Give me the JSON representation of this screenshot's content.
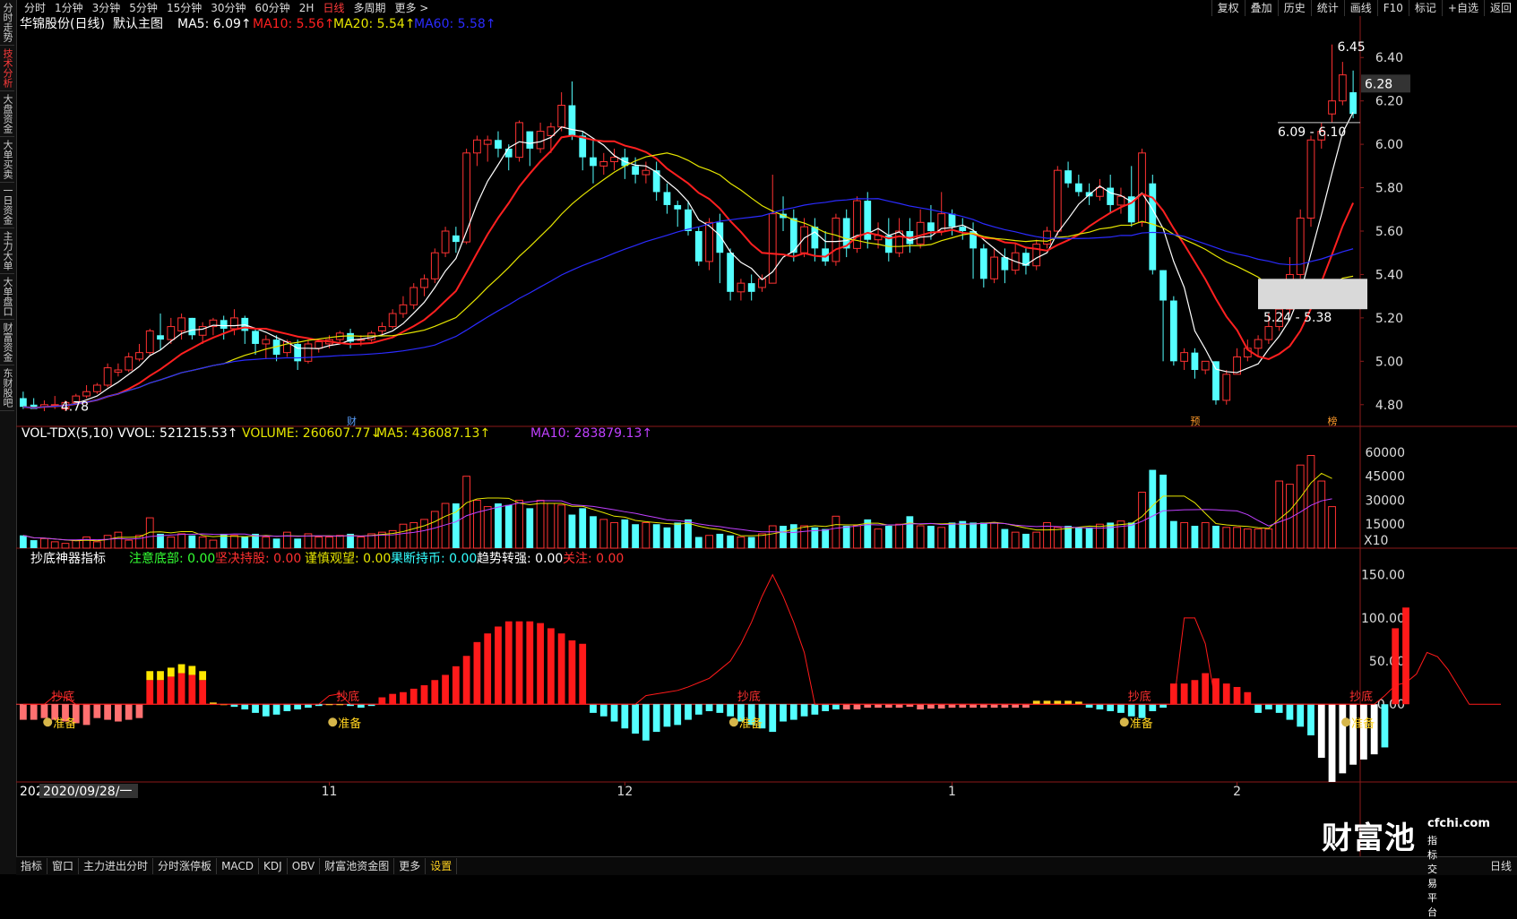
{
  "top_tabs": [
    "分时",
    "1分钟",
    "3分钟",
    "5分钟",
    "15分钟",
    "30分钟",
    "60分钟",
    "2H",
    "日线",
    "多周期",
    "更多 >"
  ],
  "active_tab": "日线",
  "top_right": [
    "复权",
    "叠加",
    "历史",
    "统计",
    "画线",
    "F10",
    "标记",
    "+自选",
    "返回"
  ],
  "side_tabs": [
    "分时走势",
    "技术分析",
    "大盘资金",
    "大单买卖",
    "一日资金",
    "主力大单",
    "大单盘口",
    "财富资金",
    "东财股吧"
  ],
  "side_active": "技术分析",
  "main": {
    "stock": "华锦股份(日线)",
    "template": "默认主图",
    "ma5": "MA5: 6.09↑",
    "ma10": "MA10: 5.56↑",
    "ma20": "MA20: 5.54↑",
    "ma60": "MA60: 5.58↑",
    "last_price": "6.28",
    "hi_label": "6.45",
    "lo_label": "4.78",
    "zone1": "6.09 - 6.10",
    "zone2": "5.24 - 5.38",
    "marker_cai": "财",
    "marker_yu": "预",
    "marker_bang": "榜"
  },
  "vol": {
    "title": "VOL-TDX(5,10) VVOL: 521215.53↑",
    "volume": "VOLUME: 260607.77↓",
    "ma5": "MA5: 436087.13↑",
    "ma10": "MA10: 283879.13↑",
    "unit": "X10"
  },
  "ind": {
    "title": "抄底神器指标",
    "f1": "注意底部: 0.00",
    "f2": "坚决持股: 0.00",
    "f3": "谨慎观望: 0.00",
    "f4": "果断持币: 0.00",
    "f5": "趋势转强: 0.00",
    "f6": "关注: 0.00",
    "sig_buy": "抄底",
    "sig_ready": "准备"
  },
  "xaxis": {
    "date": "2020/09/28/一",
    "left_stub": "202",
    "months": [
      "11",
      "12",
      "1",
      "2"
    ]
  },
  "bottom_tabs": [
    "指标",
    "窗口",
    "主力进出分时",
    "分时涨停板",
    "MACD",
    "KDJ",
    "OBV",
    "财富池资金图",
    "更多",
    "设置"
  ],
  "bottom_active": "设置",
  "bottom_right": "日线",
  "watermark": {
    "brand": "财富池",
    "url": "cfchi.com",
    "sub": "指标交易平台"
  },
  "colors": {
    "up": "#ff3232",
    "down": "#54ffff",
    "ma5": "#ffffff",
    "ma10": "#ff2020",
    "ma20": "#e6e600",
    "ma60": "#2b2bff",
    "bg": "#000000"
  },
  "chart_data": [
    {
      "type": "candlestick",
      "title": "华锦股份(日线)",
      "ylim": [
        4.7,
        6.5
      ],
      "yticks": [
        4.8,
        5.0,
        5.2,
        5.4,
        5.6,
        5.8,
        6.0,
        6.2,
        6.4
      ],
      "candles": [
        [
          4.83,
          4.86,
          4.79,
          4.78
        ],
        [
          4.8,
          4.83,
          4.78,
          4.79
        ],
        [
          4.79,
          4.82,
          4.8,
          4.77
        ],
        [
          4.8,
          4.84,
          4.8,
          4.78
        ],
        [
          4.78,
          4.82,
          4.81,
          4.77
        ],
        [
          4.81,
          4.85,
          4.84,
          4.8
        ],
        [
          4.84,
          4.89,
          4.86,
          4.83
        ],
        [
          4.86,
          4.9,
          4.89,
          4.85
        ],
        [
          4.89,
          4.99,
          4.97,
          4.88
        ],
        [
          4.95,
          4.99,
          4.96,
          4.93
        ],
        [
          4.96,
          5.04,
          5.02,
          4.95
        ],
        [
          5.01,
          5.08,
          5.04,
          5.0
        ],
        [
          5.04,
          5.15,
          5.14,
          5.03
        ],
        [
          5.12,
          5.22,
          5.1,
          5.05
        ],
        [
          5.1,
          5.2,
          5.16,
          5.08
        ],
        [
          5.14,
          5.22,
          5.2,
          5.1
        ],
        [
          5.2,
          5.2,
          5.12,
          5.1
        ],
        [
          5.12,
          5.18,
          5.16,
          5.08
        ],
        [
          5.16,
          5.2,
          5.19,
          5.12
        ],
        [
          5.19,
          5.21,
          5.15,
          5.1
        ],
        [
          5.15,
          5.24,
          5.2,
          5.12
        ],
        [
          5.2,
          5.21,
          5.14,
          5.08
        ],
        [
          5.14,
          5.15,
          5.08,
          5.03
        ],
        [
          5.08,
          5.12,
          5.1,
          5.01
        ],
        [
          5.1,
          5.12,
          5.03,
          5.0
        ],
        [
          5.04,
          5.1,
          5.09,
          5.02
        ],
        [
          5.08,
          5.1,
          5.0,
          4.96
        ],
        [
          5.0,
          5.1,
          5.08,
          4.99
        ],
        [
          5.06,
          5.1,
          5.09,
          5.04
        ],
        [
          5.08,
          5.12,
          5.1,
          5.06
        ],
        [
          5.1,
          5.14,
          5.13,
          5.08
        ],
        [
          5.13,
          5.15,
          5.09,
          5.06
        ],
        [
          5.1,
          5.12,
          5.1,
          5.07
        ],
        [
          5.1,
          5.14,
          5.13,
          5.09
        ],
        [
          5.14,
          5.18,
          5.16,
          5.12
        ],
        [
          5.16,
          5.24,
          5.22,
          5.15
        ],
        [
          5.22,
          5.3,
          5.26,
          5.2
        ],
        [
          5.26,
          5.36,
          5.34,
          5.24
        ],
        [
          5.34,
          5.4,
          5.38,
          5.3
        ],
        [
          5.38,
          5.52,
          5.5,
          5.36
        ],
        [
          5.5,
          5.62,
          5.6,
          5.48
        ],
        [
          5.58,
          5.62,
          5.55,
          5.5
        ],
        [
          5.55,
          5.98,
          5.96,
          5.54
        ],
        [
          5.96,
          6.04,
          6.02,
          5.9
        ],
        [
          6.0,
          6.04,
          6.02,
          5.92
        ],
        [
          6.02,
          6.06,
          5.98,
          5.94
        ],
        [
          5.98,
          6.0,
          5.94,
          5.88
        ],
        [
          5.94,
          6.11,
          6.1,
          5.92
        ],
        [
          6.06,
          6.05,
          5.98,
          5.9
        ],
        [
          5.98,
          6.1,
          6.06,
          5.96
        ],
        [
          6.04,
          6.1,
          6.08,
          5.96
        ],
        [
          6.08,
          6.24,
          6.18,
          6.06
        ],
        [
          6.18,
          6.29,
          6.04,
          6.02
        ],
        [
          6.04,
          6.06,
          5.94,
          5.88
        ],
        [
          5.94,
          6.02,
          5.9,
          5.82
        ],
        [
          5.9,
          5.96,
          5.92,
          5.86
        ],
        [
          5.92,
          5.98,
          5.94,
          5.88
        ],
        [
          5.94,
          5.98,
          5.9,
          5.84
        ],
        [
          5.9,
          5.94,
          5.86,
          5.82
        ],
        [
          5.86,
          5.92,
          5.88,
          5.82
        ],
        [
          5.88,
          5.92,
          5.78,
          5.74
        ],
        [
          5.78,
          5.82,
          5.72,
          5.68
        ],
        [
          5.72,
          5.74,
          5.7,
          5.62
        ],
        [
          5.7,
          5.74,
          5.6,
          5.58
        ],
        [
          5.6,
          5.62,
          5.46,
          5.44
        ],
        [
          5.46,
          5.66,
          5.64,
          5.42
        ],
        [
          5.64,
          5.68,
          5.5,
          5.36
        ],
        [
          5.5,
          5.52,
          5.32,
          5.28
        ],
        [
          5.32,
          5.38,
          5.36,
          5.28
        ],
        [
          5.36,
          5.4,
          5.32,
          5.28
        ],
        [
          5.34,
          5.4,
          5.38,
          5.32
        ],
        [
          5.36,
          5.86,
          5.68,
          5.36
        ],
        [
          5.68,
          5.76,
          5.66,
          5.6
        ],
        [
          5.66,
          5.7,
          5.5,
          5.46
        ],
        [
          5.5,
          5.66,
          5.62,
          5.48
        ],
        [
          5.62,
          5.66,
          5.52,
          5.46
        ],
        [
          5.52,
          5.6,
          5.46,
          5.44
        ],
        [
          5.46,
          5.68,
          5.66,
          5.44
        ],
        [
          5.66,
          5.7,
          5.52,
          5.48
        ],
        [
          5.52,
          5.76,
          5.74,
          5.5
        ],
        [
          5.74,
          5.78,
          5.56,
          5.52
        ],
        [
          5.56,
          5.64,
          5.58,
          5.52
        ],
        [
          5.58,
          5.66,
          5.5,
          5.46
        ],
        [
          5.5,
          5.66,
          5.6,
          5.48
        ],
        [
          5.6,
          5.66,
          5.54,
          5.5
        ],
        [
          5.54,
          5.7,
          5.64,
          5.52
        ],
        [
          5.64,
          5.72,
          5.6,
          5.56
        ],
        [
          5.6,
          5.78,
          5.68,
          5.58
        ],
        [
          5.68,
          5.7,
          5.62,
          5.58
        ],
        [
          5.62,
          5.66,
          5.6,
          5.56
        ],
        [
          5.6,
          5.64,
          5.52,
          5.38
        ],
        [
          5.52,
          5.54,
          5.38,
          5.34
        ],
        [
          5.38,
          5.52,
          5.48,
          5.36
        ],
        [
          5.48,
          5.52,
          5.42,
          5.36
        ],
        [
          5.42,
          5.54,
          5.5,
          5.4
        ],
        [
          5.5,
          5.52,
          5.44,
          5.4
        ],
        [
          5.44,
          5.56,
          5.54,
          5.42
        ],
        [
          5.54,
          5.62,
          5.6,
          5.52
        ],
        [
          5.6,
          5.9,
          5.88,
          5.58
        ],
        [
          5.88,
          5.92,
          5.82,
          5.8
        ],
        [
          5.82,
          5.86,
          5.78,
          5.76
        ],
        [
          5.78,
          5.82,
          5.76,
          5.72
        ],
        [
          5.76,
          5.84,
          5.8,
          5.74
        ],
        [
          5.8,
          5.86,
          5.72,
          5.68
        ],
        [
          5.72,
          5.8,
          5.76,
          5.68
        ],
        [
          5.76,
          5.9,
          5.64,
          5.62
        ],
        [
          5.64,
          5.98,
          5.96,
          5.62
        ],
        [
          5.82,
          5.86,
          5.42,
          5.4
        ],
        [
          5.42,
          5.32,
          5.28,
          5.0
        ],
        [
          5.28,
          5.3,
          5.0,
          4.98
        ],
        [
          5.0,
          5.06,
          5.04,
          4.96
        ],
        [
          5.04,
          5.06,
          4.96,
          4.92
        ],
        [
          4.96,
          5.0,
          5.0,
          4.94
        ],
        [
          5.0,
          5.0,
          4.82,
          4.8
        ],
        [
          4.82,
          4.96,
          4.94,
          4.8
        ],
        [
          4.94,
          5.06,
          5.02,
          4.94
        ],
        [
          5.02,
          5.1,
          5.06,
          5.0
        ],
        [
          5.06,
          5.12,
          5.1,
          5.02
        ],
        [
          5.1,
          5.22,
          5.16,
          5.08
        ],
        [
          5.16,
          5.28,
          5.24,
          5.14
        ],
        [
          5.24,
          5.48,
          5.4,
          5.22
        ],
        [
          5.4,
          5.7,
          5.66,
          5.38
        ],
        [
          5.66,
          6.04,
          6.02,
          5.62
        ],
        [
          6.02,
          6.1,
          6.06,
          5.98
        ],
        [
          6.14,
          6.46,
          6.2,
          6.1
        ],
        [
          6.2,
          6.38,
          6.32,
          6.18
        ],
        [
          6.24,
          6.34,
          6.14,
          6.12
        ]
      ],
      "ma_series": [
        "MA5",
        "MA10",
        "MA20",
        "MA60"
      ]
    },
    {
      "type": "bar",
      "title": "VOL-TDX(5,10)",
      "ylim": [
        0,
        65000
      ],
      "yticks": [
        15000,
        30000,
        45000,
        60000
      ],
      "values": [
        8000,
        5000,
        6000,
        4000,
        3000,
        5000,
        7000,
        4000,
        8000,
        10000,
        5000,
        8000,
        19000,
        9000,
        7000,
        9000,
        8000,
        7000,
        5000,
        9000,
        8000,
        7000,
        9000,
        7000,
        6000,
        10000,
        6000,
        9000,
        7000,
        7000,
        8000,
        9000,
        7000,
        9000,
        10000,
        11000,
        15000,
        16000,
        18000,
        23000,
        28000,
        28000,
        45000,
        30000,
        26000,
        28000,
        27000,
        30000,
        25000,
        30000,
        28000,
        27000,
        21000,
        25000,
        20000,
        18000,
        16000,
        18000,
        15000,
        16000,
        15000,
        13000,
        16000,
        18000,
        7000,
        8000,
        9000,
        8000,
        7000,
        7000,
        9000,
        14000,
        14000,
        15000,
        14000,
        13000,
        12000,
        20000,
        14000,
        14000,
        18000,
        12000,
        14000,
        15000,
        20000,
        14000,
        14000,
        13000,
        16000,
        17000,
        16000,
        16000,
        16000,
        12000,
        10000,
        9000,
        10000,
        16000,
        13000,
        14000,
        13000,
        13000,
        15000,
        16000,
        17000,
        16000,
        35000,
        49000,
        46000,
        17000,
        16000,
        14000,
        16000,
        14000,
        13000,
        13000,
        12000,
        12000,
        12000,
        42000,
        40000,
        52000,
        58000,
        42000,
        26000
      ]
    },
    {
      "type": "bar",
      "title": "抄底神器指标",
      "ylim": [
        -90,
        160
      ],
      "yticks": [
        0.0,
        50.0,
        100.0,
        150.0
      ],
      "values": [
        -18,
        -18,
        -16,
        -18,
        -20,
        -22,
        -24,
        -16,
        -18,
        -20,
        -18,
        -16,
        28,
        28,
        32,
        36,
        34,
        28,
        2,
        0,
        -3,
        -6,
        -10,
        -14,
        -12,
        -8,
        -6,
        -4,
        -2,
        0,
        0,
        -2,
        -4,
        -2,
        8,
        12,
        14,
        18,
        22,
        28,
        34,
        44,
        56,
        72,
        82,
        90,
        96,
        96,
        96,
        94,
        88,
        82,
        74,
        70,
        -10,
        -14,
        -20,
        -28,
        -34,
        -42,
        -32,
        -26,
        -24,
        -18,
        -12,
        -8,
        -10,
        -14,
        -20,
        -24,
        -28,
        -32,
        -20,
        -18,
        -14,
        -12,
        -8,
        -6,
        -6,
        -6,
        -4,
        -4,
        -4,
        -4,
        -3,
        -6,
        -5,
        -5,
        -4,
        -4,
        -4,
        -4,
        -4,
        -4,
        -4,
        -4,
        4,
        4,
        4,
        4,
        3,
        -4,
        -6,
        -8,
        -10,
        -14,
        -16,
        -8,
        -4,
        24,
        24,
        28,
        36,
        30,
        24,
        20,
        14,
        -10,
        -6,
        -10,
        -18,
        -26,
        -36,
        -62,
        -90,
        -80,
        -70,
        -64,
        -58,
        -50,
        88,
        112
      ],
      "line": [
        0,
        0,
        0,
        10,
        8,
        0,
        0,
        0,
        0,
        0,
        0,
        0,
        0,
        0,
        0,
        0,
        0,
        0,
        0,
        0,
        0,
        0,
        0,
        0,
        0,
        0,
        0,
        0,
        0,
        10,
        12,
        0,
        0,
        0,
        0,
        0,
        0,
        0,
        0,
        0,
        0,
        0,
        0,
        0,
        0,
        0,
        0,
        0,
        0,
        0,
        0,
        0,
        0,
        0,
        0,
        0,
        0,
        0,
        0,
        10,
        12,
        14,
        16,
        20,
        25,
        30,
        40,
        50,
        70,
        95,
        125,
        150,
        125,
        95,
        60,
        0,
        0,
        0,
        0,
        0,
        0,
        0,
        0,
        0,
        0,
        0,
        0,
        0,
        0,
        0,
        0,
        0,
        0,
        0,
        0,
        0,
        0,
        0,
        0,
        0,
        0,
        0,
        0,
        0,
        0,
        0,
        0,
        0,
        0,
        0,
        100,
        100,
        70,
        0,
        0,
        0,
        0,
        0,
        0,
        0,
        0,
        0,
        0,
        0,
        0,
        0,
        0,
        0,
        0,
        10,
        22,
        25,
        35,
        60,
        55,
        40,
        20,
        0,
        0,
        0,
        0
      ]
    }
  ]
}
